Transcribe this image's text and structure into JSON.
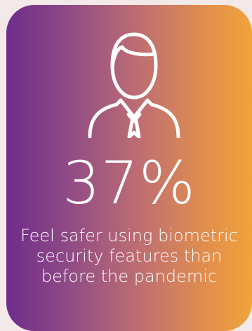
{
  "card": {
    "icon_name": "person-icon",
    "stat_value": "37%",
    "caption": "Feel safer using biometric security features than before the pandemic"
  },
  "colors": {
    "background": "#f3e9e8",
    "gradient_start": "#6f2c8a",
    "gradient_end": "#f1a33a",
    "text": "#ffffff"
  }
}
